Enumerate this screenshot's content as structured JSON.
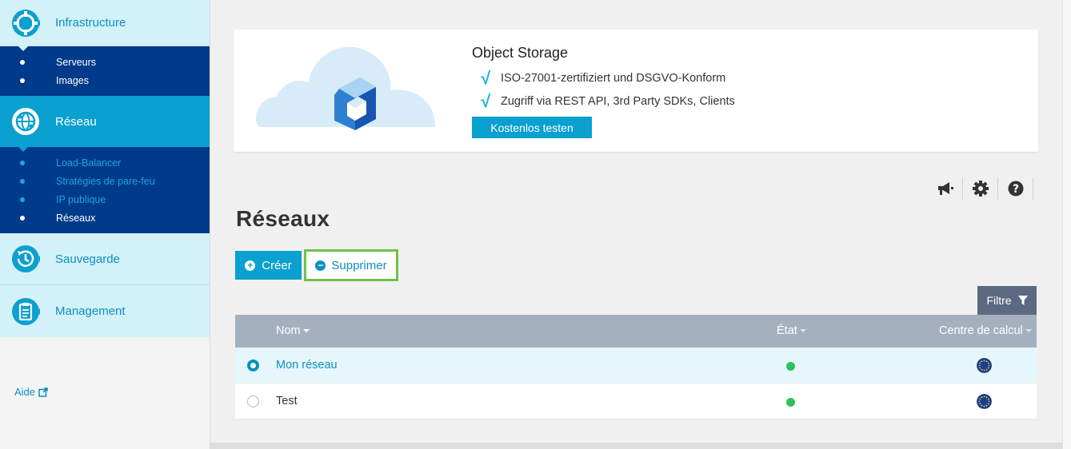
{
  "sidebar": {
    "sections": [
      {
        "key": "infrastructure",
        "label": "Infrastructure",
        "icon": "crosshair-gear-icon"
      },
      {
        "key": "reseau",
        "label": "Réseau",
        "icon": "globe-network-icon"
      },
      {
        "key": "sauvegarde",
        "label": "Sauvegarde",
        "icon": "clock-history-icon"
      },
      {
        "key": "management",
        "label": "Management",
        "icon": "clipboard-icon"
      }
    ],
    "infrastructure_items": [
      {
        "label": "Serveurs"
      },
      {
        "label": "Images"
      }
    ],
    "reseau_items": [
      {
        "label": "Load-Balancer"
      },
      {
        "label": "Stratégies de pare-feu"
      },
      {
        "label": "IP publique"
      },
      {
        "label": "Réseaux"
      }
    ],
    "help_label": "Aide",
    "help_icon": "external-link-icon"
  },
  "banner": {
    "title": "Object Storage",
    "lines": [
      "ISO-27001-zertifiziert und DSGVO-Konform",
      "Zugriff via REST API, 3rd Party SDKs, Clients"
    ],
    "button_label": "Kostenlos testen",
    "illustration": "cloud-cube-icon"
  },
  "toolbar": {
    "icons": [
      "megaphone-icon",
      "gear-icon",
      "help-circle-icon"
    ]
  },
  "page": {
    "title": "Réseaux"
  },
  "actions": {
    "create_label": "Créer",
    "delete_label": "Supprimer"
  },
  "filter": {
    "label": "Filtre",
    "icon": "funnel-icon"
  },
  "table": {
    "columns": {
      "name": "Nom",
      "state": "État",
      "datacenter": "Centre de calcul"
    },
    "rows": [
      {
        "name": "Mon réseau",
        "selected": true,
        "state_color": "#2fc05a",
        "datacenter_flag": "eu-flag-icon"
      },
      {
        "name": "Test",
        "selected": false,
        "state_color": "#2fc05a",
        "datacenter_flag": "eu-flag-icon"
      }
    ]
  },
  "colors": {
    "accent": "#0aa0d0",
    "sidebar_dark": "#003a8a",
    "sidebar_light": "#d3f1f9",
    "highlight_border": "#6cc24a",
    "status_ok": "#2fc05a"
  }
}
